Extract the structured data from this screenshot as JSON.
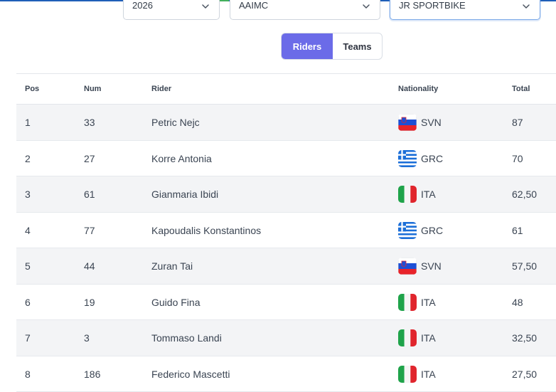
{
  "filters": {
    "year": "2026",
    "organization": "AAIMC",
    "class": "JR SPORTBIKE"
  },
  "toggle": {
    "riders_label": "Riders",
    "teams_label": "Teams",
    "active": "Riders"
  },
  "table": {
    "headers": {
      "pos": "Pos",
      "num": "Num",
      "rider": "Rider",
      "nationality": "Nationality",
      "total": "Total"
    },
    "rows": [
      {
        "pos": "1",
        "num": "33",
        "rider": "Petric Nejc",
        "flag": "slovenia-flag-icon",
        "nationality": "SVN",
        "total": "87"
      },
      {
        "pos": "2",
        "num": "27",
        "rider": "Korre Antonia",
        "flag": "greece-flag-icon",
        "nationality": "GRC",
        "total": "70"
      },
      {
        "pos": "3",
        "num": "61",
        "rider": "Gianmaria Ibidi",
        "flag": "italy-flag-icon",
        "nationality": "ITA",
        "total": "62,50"
      },
      {
        "pos": "4",
        "num": "77",
        "rider": "Kapoudalis Konstantinos",
        "flag": "greece-flag-icon",
        "nationality": "GRC",
        "total": "61"
      },
      {
        "pos": "5",
        "num": "44",
        "rider": "Zuran Tai",
        "flag": "slovenia-flag-icon",
        "nationality": "SVN",
        "total": "57,50"
      },
      {
        "pos": "6",
        "num": "19",
        "rider": "Guido Fina",
        "flag": "italy-flag-icon",
        "nationality": "ITA",
        "total": "48"
      },
      {
        "pos": "7",
        "num": "3",
        "rider": "Tommaso Landi",
        "flag": "italy-flag-icon",
        "nationality": "ITA",
        "total": "32,50"
      },
      {
        "pos": "8",
        "num": "186",
        "rider": "Federico Mascetti",
        "flag": "italy-flag-icon",
        "nationality": "ITA",
        "total": "27,50"
      }
    ]
  },
  "colors": {
    "accent": "#6b6be8",
    "row_stripe": "#f3f4f6",
    "focus_border": "#7aa8e8"
  }
}
